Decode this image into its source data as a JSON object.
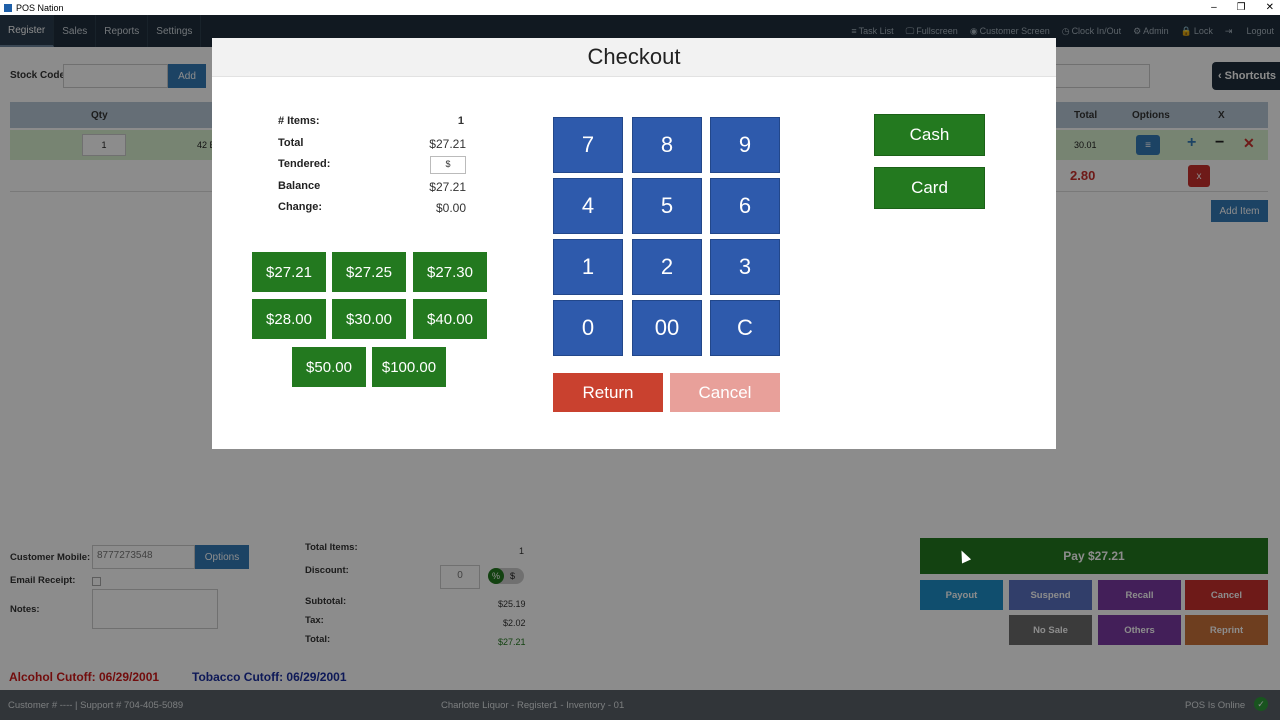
{
  "window": {
    "title": "POS Nation",
    "controls": [
      "–",
      "❐",
      "✕"
    ]
  },
  "nav": {
    "items": [
      "Register",
      "Sales",
      "Reports",
      "Settings"
    ],
    "right": [
      {
        "icon": "≡",
        "label": "Task List"
      },
      {
        "icon": "🖵",
        "label": "Fullscreen"
      },
      {
        "icon": "◉",
        "label": "Customer Screen"
      },
      {
        "icon": "◷",
        "label": "Clock In/Out"
      },
      {
        "icon": "⚙",
        "label": "Admin"
      },
      {
        "icon": "🔒",
        "label": "Lock"
      },
      {
        "icon": "⇥",
        "label": ""
      },
      {
        "icon": "",
        "label": "Logout"
      }
    ]
  },
  "stock": {
    "label": "Stock Code:",
    "add": "Add"
  },
  "shortcuts": {
    "label": "Shortcuts",
    "icon": "‹"
  },
  "table": {
    "headers": {
      "qty": "Qty",
      "total": "Total",
      "options": "Options",
      "x": "X"
    },
    "row1": {
      "qty": "1",
      "desc": "42 E",
      "total": "30.01"
    },
    "row2": {
      "amount": "2.80",
      "del": "x"
    },
    "add_item": "Add Item"
  },
  "customer": {
    "mobile_label": "Customer Mobile:",
    "mobile_value": "8777273548",
    "options": "Options",
    "email_label": "Email Receipt:",
    "notes_label": "Notes:"
  },
  "totals": {
    "items_label": "Total Items:",
    "items_value": "1",
    "discount_label": "Discount:",
    "discount_value": "0",
    "subtotal_label": "Subtotal:",
    "subtotal_value": "$25.19",
    "tax_label": "Tax:",
    "tax_value": "$2.02",
    "total_label": "Total:",
    "total_value": "$27.21"
  },
  "actions": {
    "pay": "Pay $27.21",
    "payout": "Payout",
    "suspend": "Suspend",
    "recall": "Recall",
    "cancel": "Cancel",
    "no_sale": "No Sale",
    "others": "Others",
    "reprint": "Reprint"
  },
  "cutoffs": {
    "alcohol": "Alcohol Cutoff: 06/29/2001",
    "tobacco": "Tobacco Cutoff: 06/29/2001"
  },
  "footer": {
    "left": "Customer # ---- | Support # 704-405-5089",
    "center": "Charlotte Liquor - Register1 - Inventory - 01",
    "right": "POS Is Online"
  },
  "checkout": {
    "title": "Checkout",
    "items_label": "# Items:",
    "items_value": "1",
    "total_label": "Total",
    "total_value": "$27.21",
    "tendered_label": "Tendered:",
    "tendered_value": "$",
    "balance_label": "Balance",
    "balance_value": "$27.21",
    "change_label": "Change:",
    "change_value": "$0.00",
    "quick_amounts": [
      "$27.21",
      "$27.25",
      "$27.30",
      "$28.00",
      "$30.00",
      "$40.00",
      "$50.00",
      "$100.00"
    ],
    "keypad": [
      "7",
      "8",
      "9",
      "4",
      "5",
      "6",
      "1",
      "2",
      "3",
      "0",
      "00",
      "C"
    ],
    "return": "Return",
    "cancel": "Cancel",
    "cash": "Cash",
    "card": "Card"
  }
}
